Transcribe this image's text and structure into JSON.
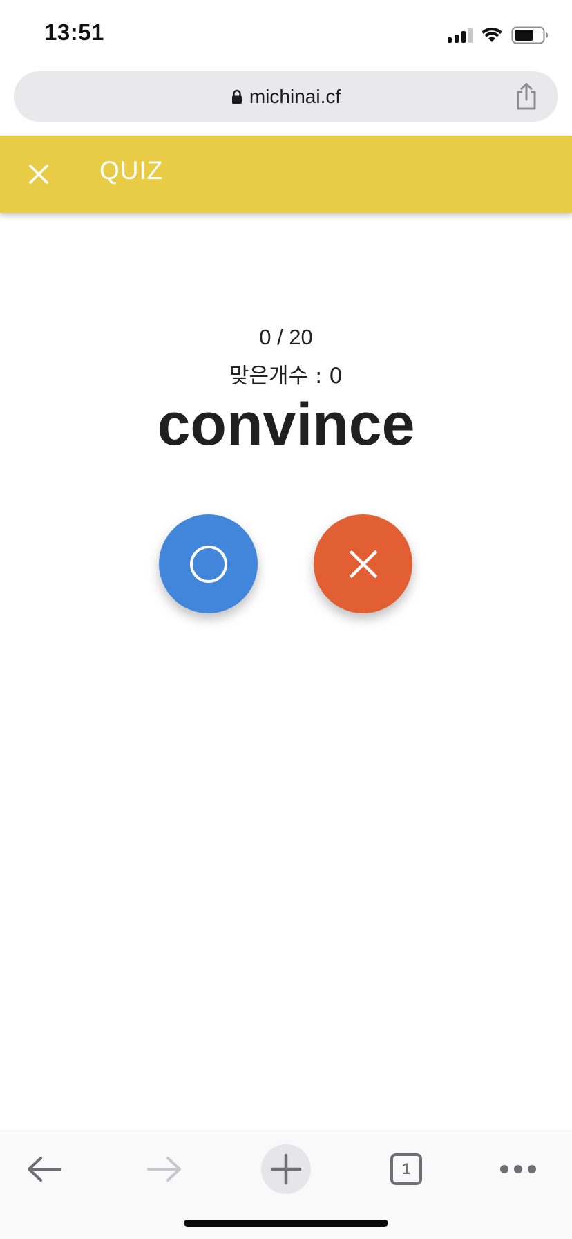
{
  "status_bar": {
    "time": "13:51"
  },
  "browser": {
    "url": "michinai.cf",
    "tab_count": "1"
  },
  "app_header": {
    "title": "QUIZ",
    "close_icon": "close-icon"
  },
  "quiz": {
    "progress": "0 / 20",
    "correct_count": "맞은개수 : 0",
    "word": "convince",
    "answer_o_icon": "circle-o-icon",
    "answer_x_icon": "x-mark-icon"
  },
  "colors": {
    "header_bg": "#e8cc46",
    "o_button": "#4286dc",
    "x_button": "#e15f33"
  },
  "toolbar": {
    "icons": [
      "back-arrow-icon",
      "forward-arrow-icon",
      "new-tab-plus-icon",
      "tabs-icon",
      "more-icon"
    ]
  }
}
